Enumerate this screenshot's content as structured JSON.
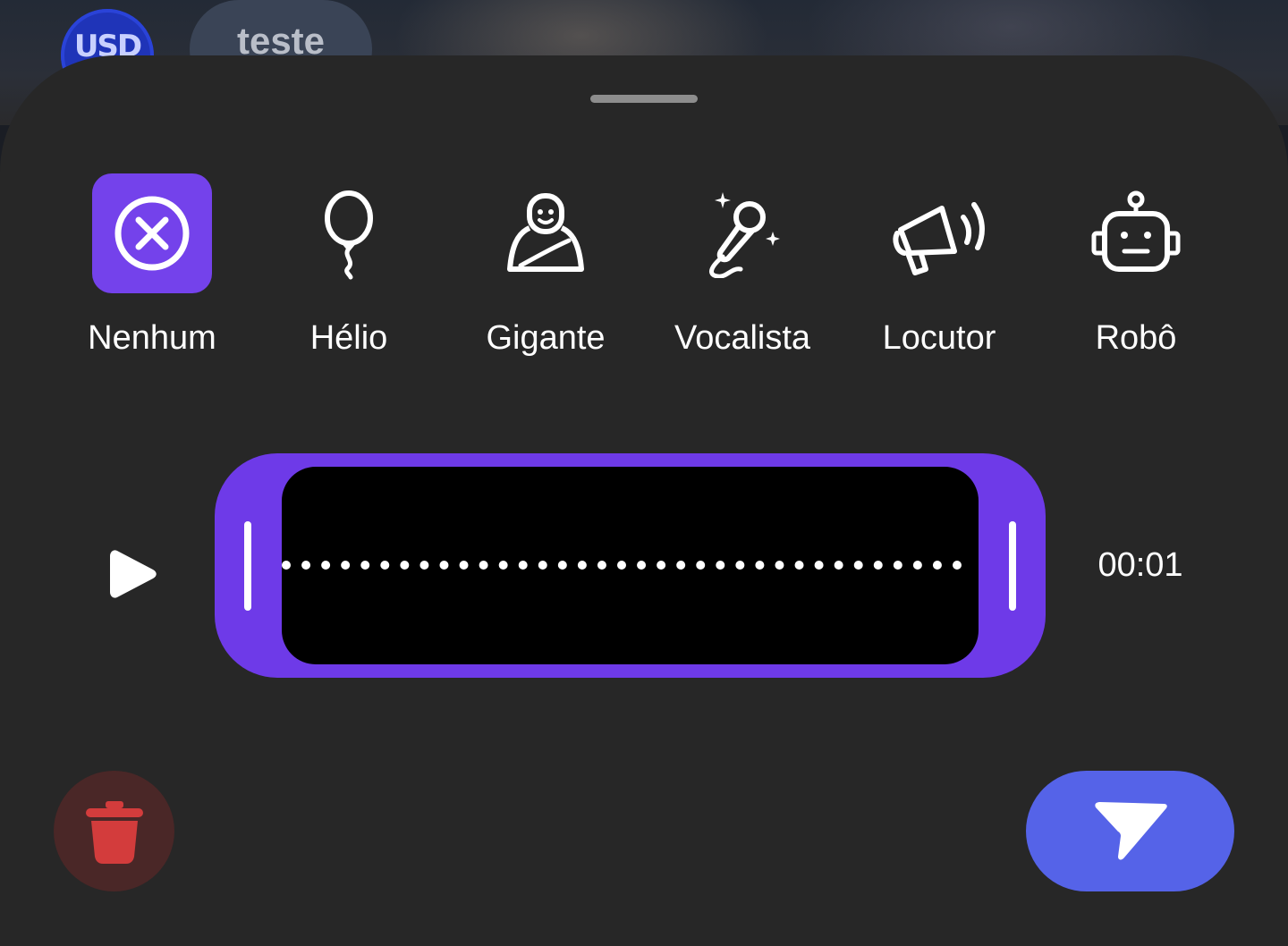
{
  "background_chat": {
    "avatar_text": "USD",
    "chat_name": "teste"
  },
  "voice_effects": {
    "selected": "Nenhum",
    "items": [
      {
        "label": "Nenhum",
        "icon": "close-circle-icon"
      },
      {
        "label": "Hélio",
        "icon": "balloon-icon"
      },
      {
        "label": "Gigante",
        "icon": "giant-icon"
      },
      {
        "label": "Vocalista",
        "icon": "microphone-icon"
      },
      {
        "label": "Locutor",
        "icon": "megaphone-icon"
      },
      {
        "label": "Robô",
        "icon": "robot-icon"
      }
    ]
  },
  "recording": {
    "duration": "00:01",
    "waveform_dots": 35
  },
  "actions": {
    "delete_icon": "trash-icon",
    "send_icon": "send-icon"
  },
  "colors": {
    "sheet_background": "#272727",
    "accent_purple": "#6e3ae8",
    "send_blue": "#5563e8",
    "delete_red": "#d33c3c",
    "delete_background": "#4a2727"
  }
}
